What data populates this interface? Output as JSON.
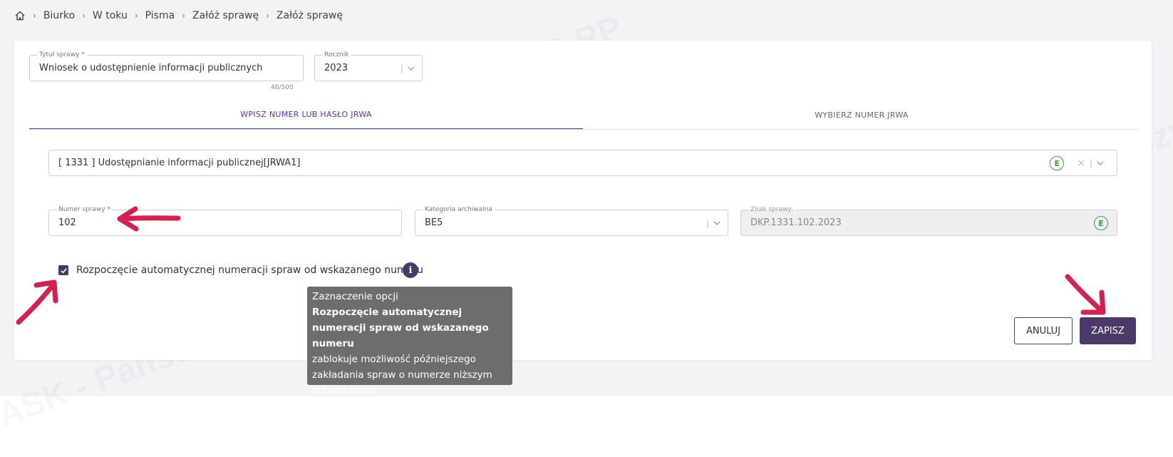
{
  "breadcrumb": {
    "items": [
      "Biurko",
      "W toku",
      "Pisma",
      "Załóż sprawę",
      "Załóż sprawę"
    ]
  },
  "form": {
    "title_field": {
      "label": "Tytuł sprawy *",
      "value": "Wniosek o udostępnienie informacji publicznych",
      "counter": "46/500"
    },
    "year_field": {
      "label": "Rocznik",
      "value": "2023"
    },
    "tabs": [
      {
        "label": "WPISZ NUMER LUB HASŁO JRWA",
        "active": true
      },
      {
        "label": "WYBIERZ NUMER JRWA",
        "active": false
      }
    ],
    "jrwa_field": {
      "value": "[ 1331 ] Udostępnianie informacji publicznej[JRWA1]",
      "badge": "E"
    },
    "case_number_field": {
      "label": "Numer sprawy *",
      "value": "102"
    },
    "archive_category_field": {
      "label": "Kategoria archiwalna",
      "value": "BE5"
    },
    "case_sign_field": {
      "label": "Znak sprawy:",
      "value": "DKP.1331.102.2023",
      "badge": "E"
    },
    "auto_numbering": {
      "checked": true,
      "label": "Rozpoczęcie automatycznej numeracji spraw od wskazanego numeru"
    },
    "tooltip": {
      "line1": "Zaznaczenie opcji",
      "bold": "Rozpoczęcie automatycznej numeracji spraw od wskazanego numeru",
      "rest": "zablokuje możliwość późniejszego zakładania spraw o numerze niższym niż wskazany."
    },
    "buttons": {
      "cancel": "ANULUJ",
      "save": "ZAPISZ"
    }
  },
  "watermark": {
    "text": "NASK - Państwowy Instytut Badawczy",
    "logo": "EZD RP"
  },
  "colors": {
    "accent": "#5b2fb3",
    "primary_dark": "#4a3a6a",
    "arrow": "#d6204d",
    "badge_green": "#3a9a3a"
  }
}
